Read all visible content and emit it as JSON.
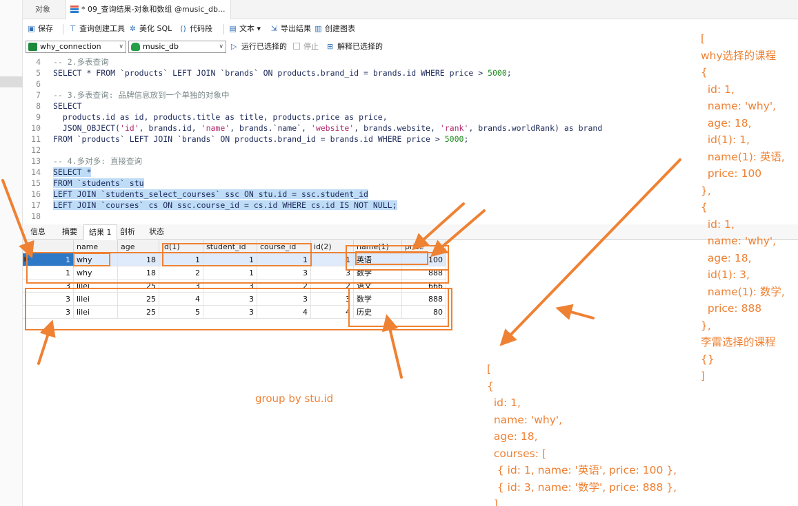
{
  "tabs": {
    "objects": "对象",
    "query": "* 09_查询结果-对象和数组 @music_db..."
  },
  "toolbar": {
    "save": "保存",
    "query_builder": "查询创建工具",
    "beautify": "美化 SQL",
    "snippet": "代码段",
    "text": "文本 ▾",
    "export": "导出结果",
    "chart": "创建图表"
  },
  "connection": {
    "connection": "why_connection",
    "database": "music_db",
    "run_selected": "运行已选择的",
    "stop": "停止",
    "explain": "解释已选择的"
  },
  "code": [
    {
      "no": "4",
      "text": "-- 2.多表查询",
      "comment": true,
      "sel": false
    },
    {
      "no": "5",
      "text": "SELECT * FROM `products` LEFT JOIN `brands` ON products.brand_id = brands.id WHERE price > 5000;",
      "comment": false,
      "sel": false
    },
    {
      "no": "6",
      "text": "",
      "comment": false,
      "sel": false
    },
    {
      "no": "7",
      "text": "-- 3.多表查询: 品牌信息放到一个单独的对象中",
      "comment": true,
      "sel": false
    },
    {
      "no": "8",
      "text": "SELECT",
      "comment": false,
      "sel": false
    },
    {
      "no": "9",
      "text": "  products.id as id, products.title as title, products.price as price,",
      "comment": false,
      "sel": false
    },
    {
      "no": "10",
      "text": "  JSON_OBJECT('id', brands.id, 'name', brands.`name`, 'website', brands.website, 'rank', brands.worldRank) as brand",
      "comment": false,
      "sel": false
    },
    {
      "no": "11",
      "text": "FROM `products` LEFT JOIN `brands` ON products.brand_id = brands.id WHERE price > 5000;",
      "comment": false,
      "sel": false
    },
    {
      "no": "12",
      "text": "",
      "comment": false,
      "sel": false
    },
    {
      "no": "13",
      "text": "-- 4.多对多: 直接查询",
      "comment": true,
      "sel": false
    },
    {
      "no": "14",
      "text": "SELECT *",
      "comment": false,
      "sel": true
    },
    {
      "no": "15",
      "text": "FROM `students` stu",
      "comment": false,
      "sel": true
    },
    {
      "no": "16",
      "text": "LEFT JOIN `students_select_courses` ssc ON stu.id = ssc.student_id",
      "comment": false,
      "sel": true
    },
    {
      "no": "17",
      "text": "LEFT JOIN `courses` cs ON ssc.course_id = cs.id WHERE cs.id IS NOT NULL;",
      "comment": false,
      "sel": true
    },
    {
      "no": "18",
      "text": "",
      "comment": false,
      "sel": false
    }
  ],
  "result_tabs": [
    "信息",
    "摘要",
    "结果 1",
    "剖析",
    "状态"
  ],
  "grid": {
    "columns": [
      "id",
      "name",
      "age",
      "id(1)",
      "student_id",
      "course_id",
      "id(2)",
      "name(1)",
      "price"
    ],
    "rows": [
      [
        "1",
        "why",
        "18",
        "1",
        "1",
        "1",
        "1",
        "英语",
        "100"
      ],
      [
        "1",
        "why",
        "18",
        "2",
        "1",
        "3",
        "3",
        "数学",
        "888"
      ],
      [
        "3",
        "lilei",
        "25",
        "3",
        "3",
        "2",
        "2",
        "语文",
        "666"
      ],
      [
        "3",
        "lilei",
        "25",
        "4",
        "3",
        "3",
        "3",
        "数学",
        "888"
      ],
      [
        "3",
        "lilei",
        "25",
        "5",
        "3",
        "4",
        "4",
        "历史",
        "80"
      ]
    ]
  },
  "annotations": {
    "group_by": "group by stu.id",
    "right_note": "[\nwhy选择的课程\n{\n  id: 1,\n  name: 'why',\n  age: 18,\n  id(1): 1,\n  name(1): 英语,\n  price: 100\n},\n{\n  id: 1,\n  name: 'why',\n  age: 18,\n  id(1): 3,\n  name(1): 数学,\n  price: 888\n},\n李雷选择的课程\n{}\n]",
    "bottom_note": "[\n{\n  id: 1,\n  name: 'why',\n  age: 18,\n  courses: [\n   { id: 1, name: '英语', price: 100 },\n   { id: 3, name: '数学', price: 888 },\n  ]"
  },
  "colors": {
    "annotation": "#ef8133",
    "selection": "#bfdcf7",
    "keyword": "#1a3fb3"
  }
}
